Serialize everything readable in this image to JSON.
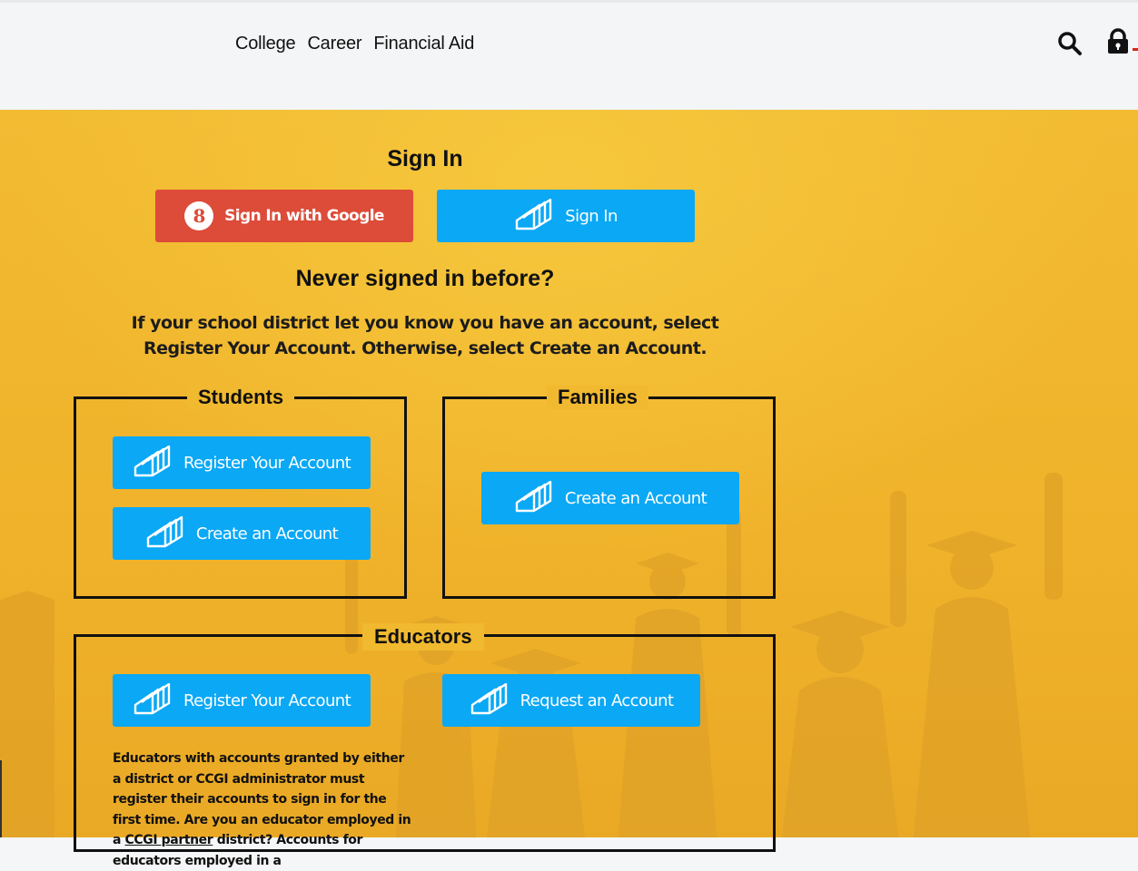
{
  "nav": {
    "items": [
      "College",
      "Career",
      "Financial Aid"
    ]
  },
  "signin": {
    "title": "Sign In",
    "google_label": "Sign In with Google",
    "google_glyph": "8",
    "signin_label": "Sign In"
  },
  "never": {
    "title": "Never signed in before?",
    "info": "If your school district let you know you have an account, select Register Your Account. Otherwise, select Create an Account."
  },
  "students": {
    "legend": "Students",
    "register_label": "Register Your Account",
    "create_label": "Create an Account"
  },
  "families": {
    "legend": "Families",
    "create_label": "Create an Account"
  },
  "educators": {
    "legend": "Educators",
    "register_label": "Register Your Account",
    "request_label": "Request an Account",
    "desc_before_link": "Educators with accounts granted by either a district or CCGI administrator must register their accounts to sign in for the first time. Are you an educator employed in a ",
    "link_text": "CCGI partner",
    "desc_after_link": " district? Accounts for educators employed in a"
  },
  "colors": {
    "google": "#dd4b39",
    "blue": "#0aa8f5",
    "background": "#f0b52c",
    "header": "#f3f5f7"
  },
  "icons": [
    "search-icon",
    "lock-icon",
    "google-icon",
    "book-icon"
  ]
}
